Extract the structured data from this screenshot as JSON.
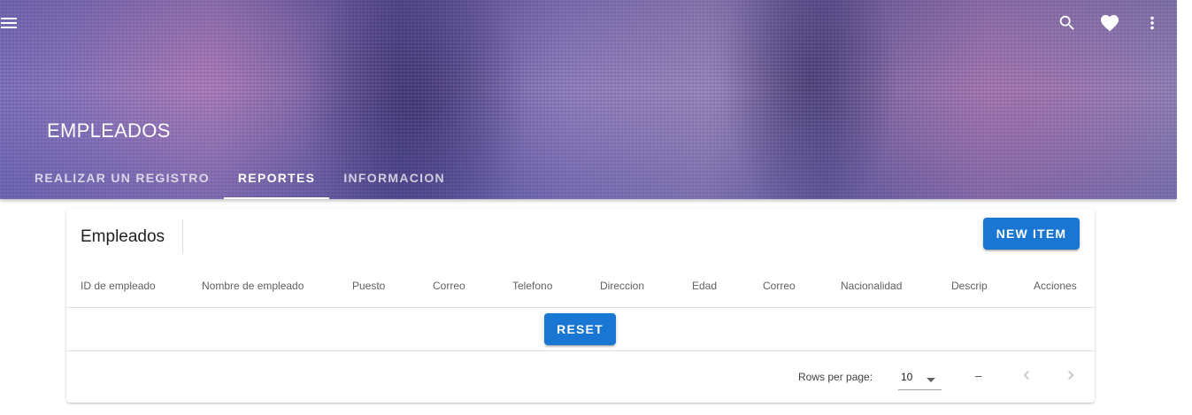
{
  "header": {
    "title": "EMPLEADOS",
    "icons": [
      "menu-icon",
      "search-icon",
      "heart-icon",
      "more-vert-icon"
    ],
    "tabs": [
      {
        "label": "REALIZAR UN REGISTRO",
        "active": false
      },
      {
        "label": "REPORTES",
        "active": true
      },
      {
        "label": "INFORMACION",
        "active": false
      }
    ]
  },
  "card": {
    "title": "Empleados",
    "new_item_label": "NEW ITEM",
    "columns": [
      "ID de empleado",
      "Nombre de empleado",
      "Puesto",
      "Correo",
      "Telefono",
      "Direccion",
      "Edad",
      "Correo",
      "Nacionalidad",
      "Descrip",
      "Acciones"
    ],
    "reset_label": "RESET"
  },
  "footer": {
    "rows_per_page_label": "Rows per page:",
    "rows_per_page_value": "10",
    "page_range": "–"
  },
  "colors": {
    "primary": "#1976d2",
    "header_accent": "#7d6fbd"
  }
}
